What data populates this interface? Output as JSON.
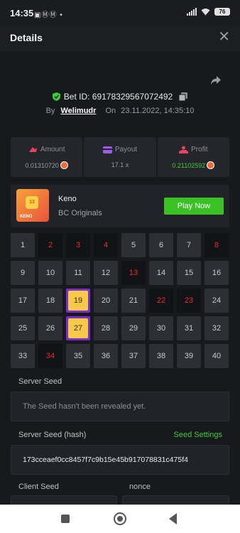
{
  "status_bar": {
    "time": "14:35",
    "notification_icons": "▣ⓂⓂ •",
    "battery": "76"
  },
  "header": {
    "title": "Details",
    "close_icon": "close-icon"
  },
  "bet": {
    "id_label": "Bet ID: 69178329567072492",
    "by_label": "By",
    "username": "Welimudr",
    "on_label": "On",
    "datetime": "23.11.2022, 14:35:10"
  },
  "stats": {
    "amount": {
      "label": "Amount",
      "value": "0.01310720"
    },
    "payout": {
      "label": "Payout",
      "value": "17.1 x"
    },
    "profit": {
      "label": "Profit",
      "value": "0.21102592"
    }
  },
  "game": {
    "name": "Keno",
    "provider": "BC Originals",
    "play_label": "Play Now",
    "thumb_number": "13",
    "thumb_label": "KENO"
  },
  "keno": {
    "numbers": [
      "1",
      "2",
      "3",
      "4",
      "5",
      "6",
      "7",
      "8",
      "9",
      "10",
      "11",
      "12",
      "13",
      "14",
      "15",
      "16",
      "17",
      "18",
      "19",
      "20",
      "21",
      "22",
      "23",
      "24",
      "25",
      "26",
      "27",
      "28",
      "29",
      "30",
      "31",
      "32",
      "33",
      "34",
      "35",
      "36",
      "37",
      "38",
      "39",
      "40"
    ],
    "drawn": [
      2,
      3,
      4,
      8,
      13,
      22,
      23,
      34
    ],
    "matched": [
      19,
      27
    ],
    "colors": {
      "cell": "#2d2f35",
      "drawn_bg": "#121316",
      "drawn_text": "#e2302d",
      "match_border": "#7b2ec9",
      "match_fill": "#f7c94a"
    }
  },
  "seeds": {
    "server_seed_label": "Server Seed",
    "server_seed_value": "The Seed hasn't been revealed yet.",
    "server_hash_label": "Server Seed (hash)",
    "seed_settings_label": "Seed Settings",
    "server_hash_value": "173cceaef0cc8457f7c9b15e45b917078831c475f4",
    "client_seed_label": "Client Seed",
    "nonce_label": "nonce"
  },
  "accent_colors": {
    "green": "#3ac225",
    "profit": "#3fcb3a"
  }
}
